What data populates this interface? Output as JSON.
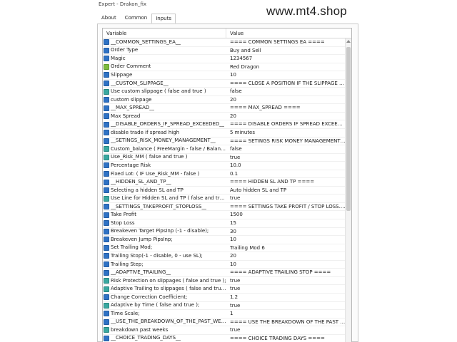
{
  "window": {
    "title": "Expert - Drakon_fix"
  },
  "watermark": "www.mt4.shop",
  "tabs": [
    {
      "label": "About",
      "active": false
    },
    {
      "label": "Common",
      "active": false
    },
    {
      "label": "Inputs",
      "active": true
    }
  ],
  "table": {
    "columns": {
      "variable": "Variable",
      "value": "Value"
    },
    "rows": [
      {
        "icon": "v2",
        "variable": "__COMMON_SETTINGS_EA__",
        "value": "==== COMMON SETTINGS EA ===="
      },
      {
        "icon": "v2",
        "variable": "Order Type",
        "value": "Buy and Sell"
      },
      {
        "icon": "v2",
        "variable": "Magic",
        "value": "1234567"
      },
      {
        "icon": "ab",
        "variable": "Order Comment",
        "value": "Red Dragon"
      },
      {
        "icon": "v2",
        "variable": "Slippage",
        "value": "10"
      },
      {
        "icon": "v2",
        "variable": "__CUSTOM_SLIPPAGE__",
        "value": "==== CLOSE A POSITION IF THE SLIPPAGE IS MO..."
      },
      {
        "icon": "sw",
        "variable": "Use custom slippage ( false and true )",
        "value": "false"
      },
      {
        "icon": "v2",
        "variable": "custom slippage",
        "value": "20"
      },
      {
        "icon": "v2",
        "variable": "__MAX_SPREAD__",
        "value": "==== MAX_SPREAD ===="
      },
      {
        "icon": "v2",
        "variable": "Max Spread",
        "value": "20"
      },
      {
        "icon": "v2",
        "variable": "__DISABLE_ORDERS_IF_SPREAD_EXCEEDED__",
        "value": "==== DISABLE ORDERS IF SPREAD EXCEEDED =..."
      },
      {
        "icon": "v2",
        "variable": "disable trade if spread high",
        "value": "5 minutes"
      },
      {
        "icon": "v2",
        "variable": "__SETINGS_RISK_MONEY_MANAGEMENT__",
        "value": "==== SETINGS RISK MONEY MANAGEMENT ===="
      },
      {
        "icon": "sw",
        "variable": "Custom_balance ( FreeMargin - false / Balance -...",
        "value": "false"
      },
      {
        "icon": "sw",
        "variable": "Use_Risk_MM ( false and true )",
        "value": "true"
      },
      {
        "icon": "v2",
        "variable": "Percentage Risk",
        "value": "10.0"
      },
      {
        "icon": "v2",
        "variable": "Fixed Lot: ( IF  Use_Risk_MM - false )",
        "value": "0.1"
      },
      {
        "icon": "v2",
        "variable": "__HIDDEN_SL_AND_TP__",
        "value": "==== HIDDEN SL AND TP ===="
      },
      {
        "icon": "v2",
        "variable": "Selecting a hidden SL and TP",
        "value": "Auto hidden SL and TP"
      },
      {
        "icon": "sw",
        "variable": "Use Line for Hidden SL and TP ( false and true )",
        "value": "true"
      },
      {
        "icon": "v2",
        "variable": "__SETTINGS_TAKEPROFIT_STOPLOSS__",
        "value": "==== SETTINGS TAKE PROFIT / STOP LOSS. ( 0 -- ..."
      },
      {
        "icon": "v2",
        "variable": "Take Profit",
        "value": "1500"
      },
      {
        "icon": "v2",
        "variable": "Stop Loss",
        "value": "15"
      },
      {
        "icon": "v2",
        "variable": "Breakeven Target PipsInp (-1 - disable);",
        "value": "30"
      },
      {
        "icon": "v2",
        "variable": "Breakeven Jump PipsInp;",
        "value": "10"
      },
      {
        "icon": "v2",
        "variable": "Set Trailing Mod;",
        "value": "Trailing Mod 6"
      },
      {
        "icon": "v2",
        "variable": "Trailing Stop(-1 - disable, 0 - use SL);",
        "value": "20"
      },
      {
        "icon": "v2",
        "variable": "Trailing Step;",
        "value": "10"
      },
      {
        "icon": "v2",
        "variable": "__ADAPTIVE_TRAILING__",
        "value": "==== ADAPTIVE TRAILING STOP ===="
      },
      {
        "icon": "sw",
        "variable": "Risk Protection on slippages ( false and true );",
        "value": "true"
      },
      {
        "icon": "sw",
        "variable": "Adaptive Trailing to slippages ( false and true );",
        "value": "true"
      },
      {
        "icon": "v2",
        "variable": "Change Correction Coefficient;",
        "value": "1.2"
      },
      {
        "icon": "sw",
        "variable": "Adaptive by Time ( false and true );",
        "value": "true"
      },
      {
        "icon": "v2",
        "variable": "Time Scale;",
        "value": "1"
      },
      {
        "icon": "v2",
        "variable": "__USE_THE_BREAKDOWN_OF_THE_PAST_WEEKS...",
        "value": "==== USE THE BREAKDOWN OF THE PAST WEEKS..."
      },
      {
        "icon": "sw",
        "variable": "breakdown past weeks",
        "value": "true"
      },
      {
        "icon": "v2",
        "variable": "__CHOICE_TRADING_DAYS__",
        "value": "==== CHOICE TRADING DAYS ===="
      }
    ]
  },
  "colors": {
    "blue_icon": "#2f72c4",
    "green_icon": "#7dbb3e",
    "teal_icon": "#3aa8a0"
  }
}
